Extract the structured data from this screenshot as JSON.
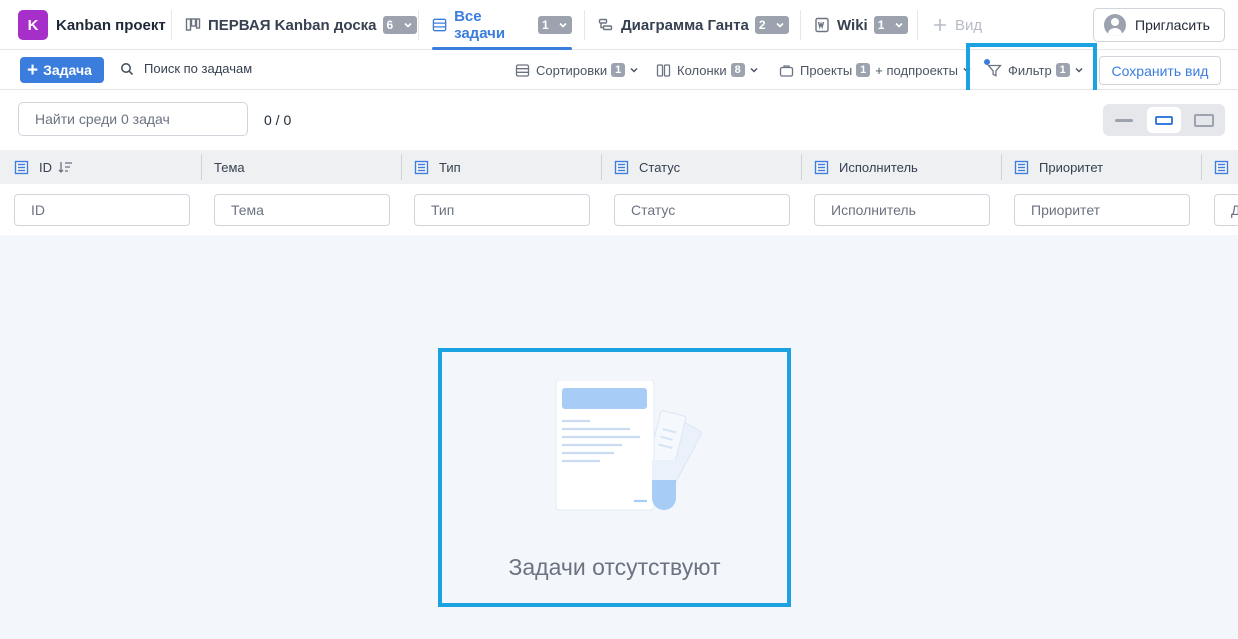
{
  "topbar": {
    "project": {
      "initial": "K",
      "name": "Kanban проект"
    },
    "tabs": [
      {
        "label": "ПЕРВАЯ Kanban доска",
        "count": "6",
        "icon": "kanban-board-icon"
      },
      {
        "label": "Все задачи",
        "count": "1",
        "icon": "list-icon",
        "active": true
      },
      {
        "label": "Диаграмма Ганта",
        "count": "2",
        "icon": "gantt-icon"
      },
      {
        "label": "Wiki",
        "count": "1",
        "icon": "wiki-icon"
      }
    ],
    "add_view": "Вид",
    "invite": "Пригласить"
  },
  "toolbar": {
    "new_task": "Задача",
    "search": "Поиск по задачам",
    "sort": {
      "label": "Сортировки",
      "count": "1"
    },
    "columns": {
      "label": "Колонки",
      "count": "8"
    },
    "projects": {
      "label": "Проекты",
      "count": "1",
      "suffix": "+ подпроекты"
    },
    "filter": {
      "label": "Фильтр",
      "count": "1"
    },
    "save_view": "Сохранить вид"
  },
  "subbar": {
    "find_placeholder": "Найти среди 0 задач",
    "counter": "0 / 0"
  },
  "table": {
    "columns": [
      "ID",
      "Тема",
      "Тип",
      "Статус",
      "Исполнитель",
      "Приоритет"
    ],
    "filters": [
      "ID",
      "Тема",
      "Тип",
      "Статус",
      "Исполнитель",
      "Приоритет",
      "Д"
    ]
  },
  "empty_state": {
    "text": "Задачи отсутствуют"
  },
  "colors": {
    "accent": "#3b7ddd",
    "highlight": "#1aa3e0",
    "project_avatar": "#a62ec9"
  }
}
